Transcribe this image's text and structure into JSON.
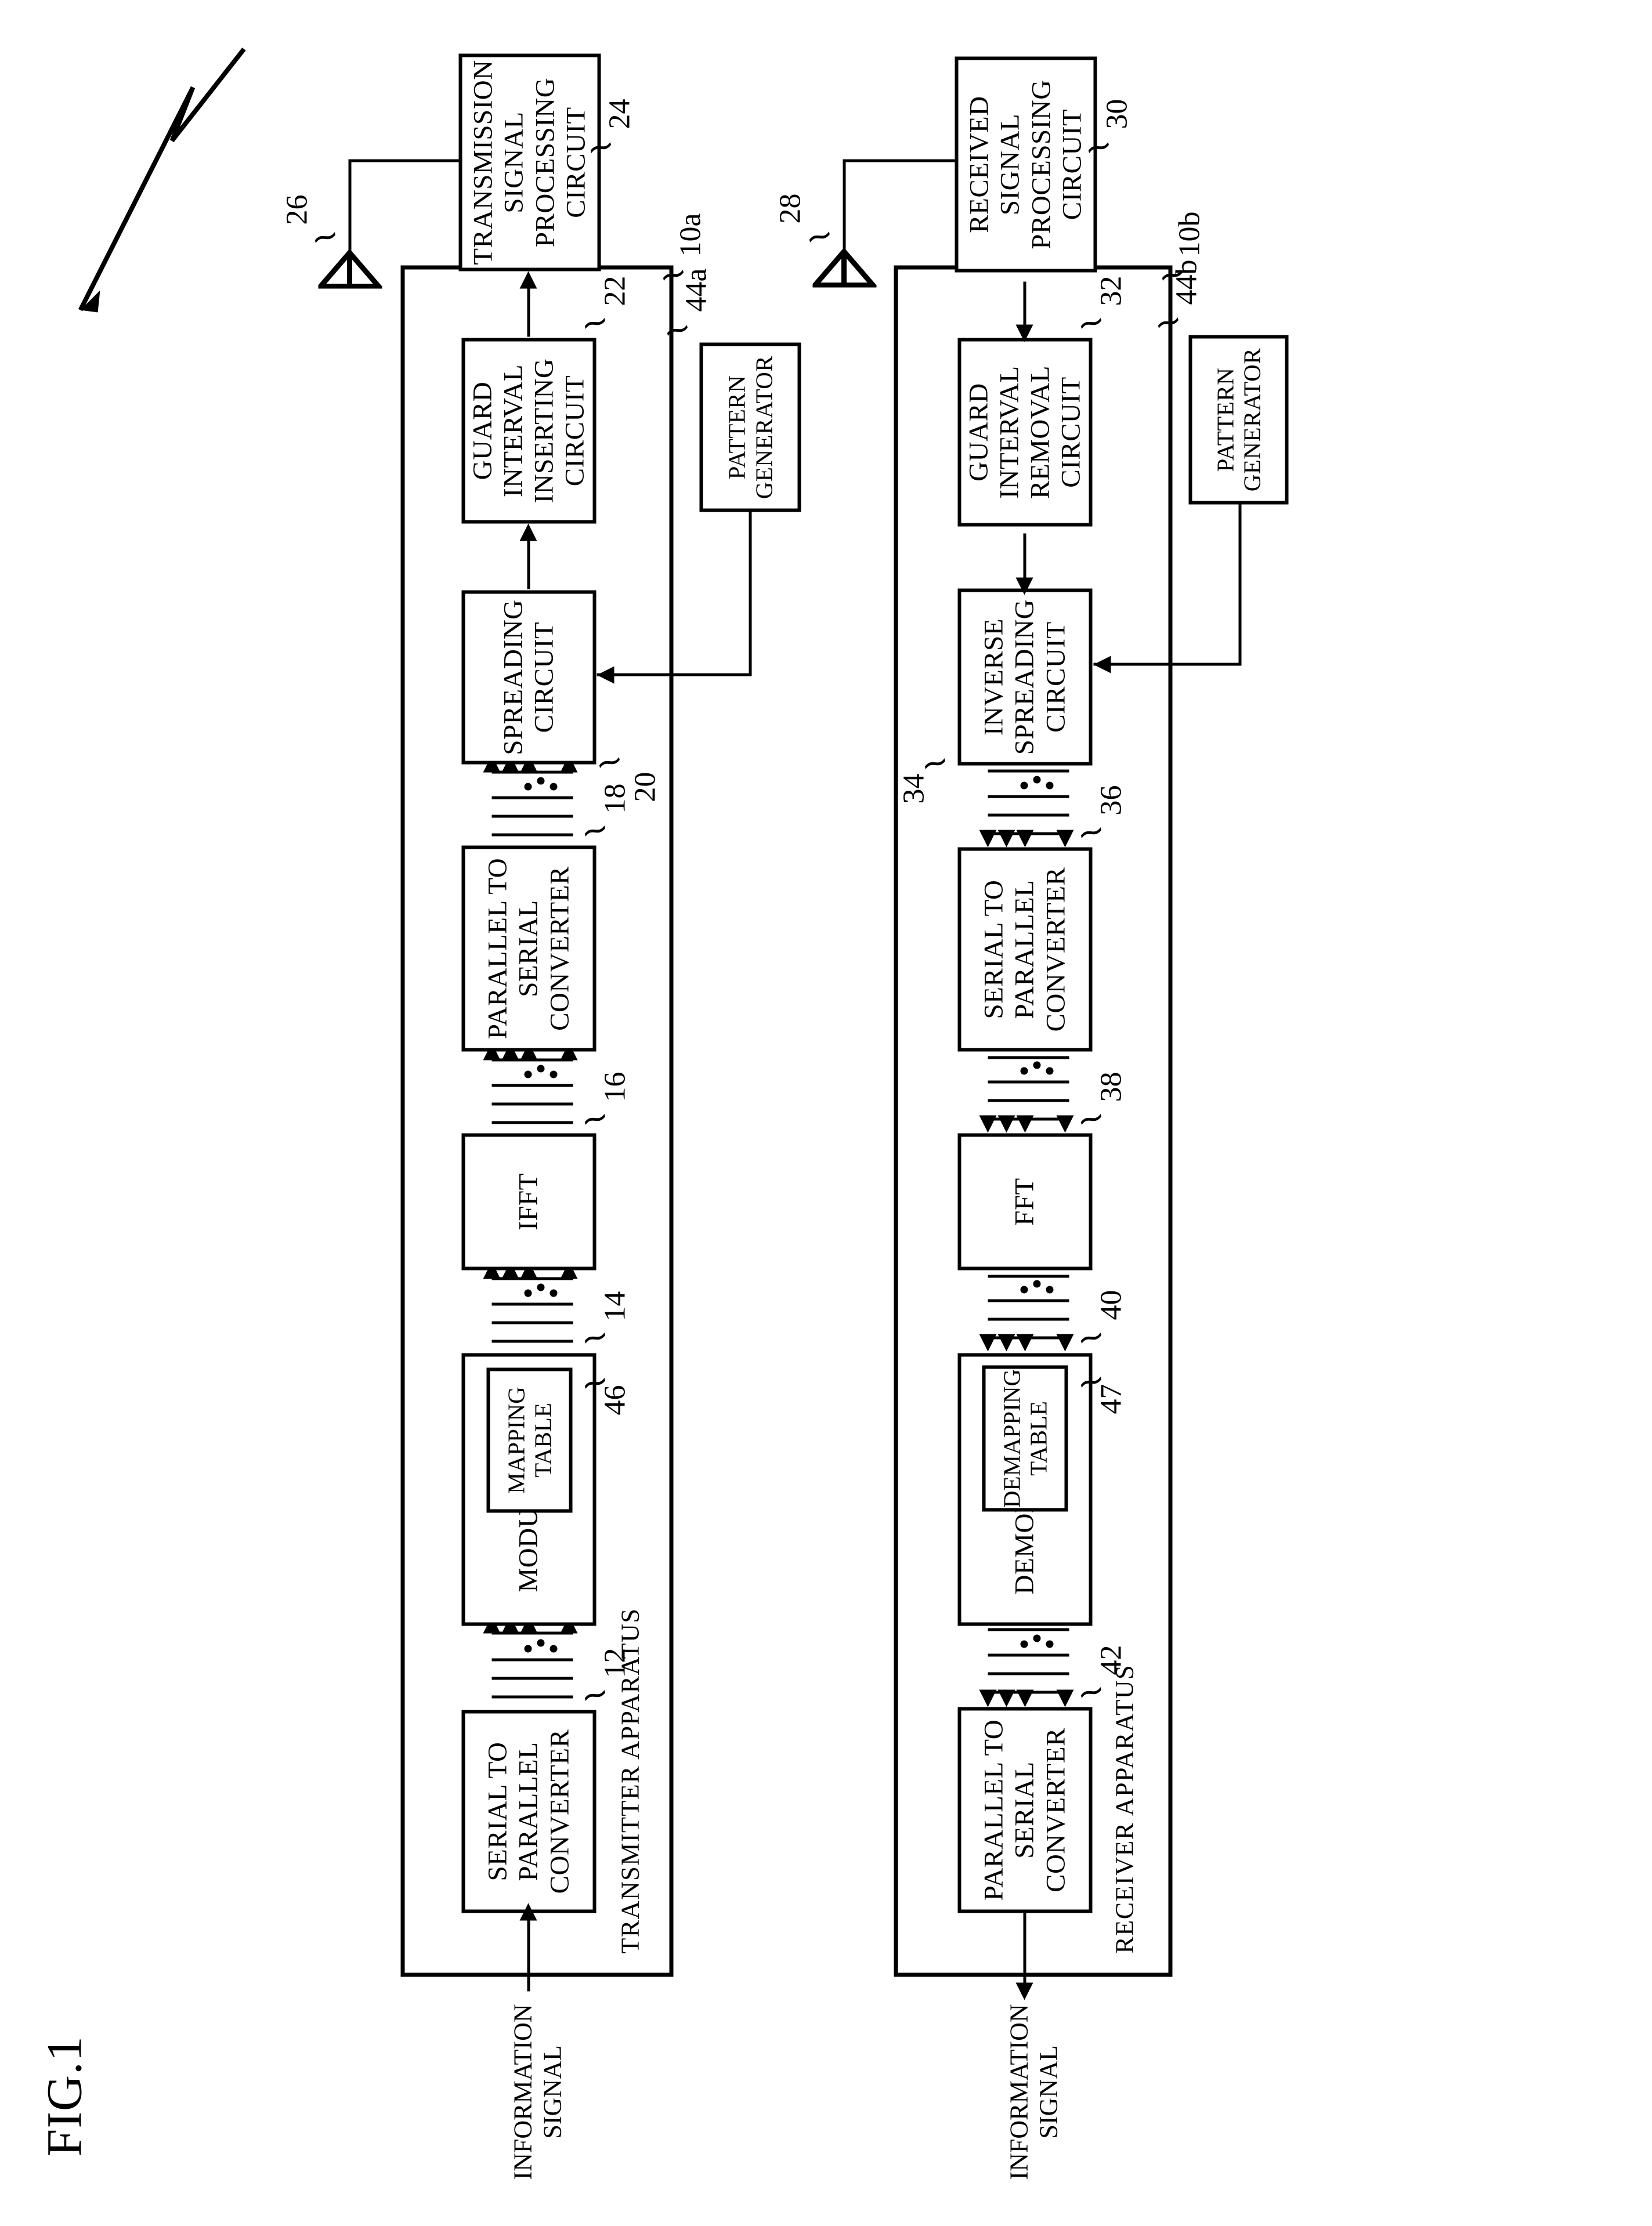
{
  "figure": {
    "label": "FIG.1",
    "type": "patent-block-diagram",
    "orientation": "rotated-90-ccw"
  },
  "transmitter": {
    "frame_label": "TRANSMITTER APPARATUS",
    "frame_ref": "10a",
    "antenna_ref": "26",
    "input_label_line1": "INFORMATION",
    "input_label_line2": "SIGNAL",
    "blocks": [
      {
        "ref": "12",
        "lines": [
          "SERIAL TO",
          "PARALLEL",
          "CONVERTER"
        ]
      },
      {
        "ref": "14",
        "lines": [
          "MODULATOR"
        ]
      },
      {
        "ref": "46",
        "lines": [
          "MAPPING",
          "TABLE"
        ]
      },
      {
        "ref": "16",
        "lines": [
          "IFFT"
        ]
      },
      {
        "ref": "18",
        "lines": [
          "PARALLEL TO",
          "SERIAL",
          "CONVERTER"
        ]
      },
      {
        "ref": "20",
        "lines": [
          "SPREADING",
          "CIRCUIT"
        ]
      },
      {
        "ref": "22",
        "lines": [
          "GUARD",
          "INTERVAL",
          "INSERTING",
          "CIRCUIT"
        ]
      },
      {
        "ref": "24",
        "lines": [
          "TRANSMISSION",
          "SIGNAL",
          "PROCESSING",
          "CIRCUIT"
        ]
      },
      {
        "ref": "44a",
        "lines": [
          "PATTERN",
          "GENERATOR"
        ]
      }
    ]
  },
  "receiver": {
    "frame_label": "RECEIVER APPARATUS",
    "frame_ref": "10b",
    "antenna_ref": "28",
    "output_label_line1": "INFORMATION",
    "output_label_line2": "SIGNAL",
    "blocks": [
      {
        "ref": "30",
        "lines": [
          "RECEIVED",
          "SIGNAL",
          "PROCESSING",
          "CIRCUIT"
        ]
      },
      {
        "ref": "32",
        "lines": [
          "GUARD",
          "INTERVAL",
          "REMOVAL",
          "CIRCUIT"
        ]
      },
      {
        "ref": "34",
        "lines": [
          "INVERSE",
          "SPREADING",
          "CIRCUIT"
        ]
      },
      {
        "ref": "36",
        "lines": [
          "SERIAL TO",
          "PARALLEL",
          "CONVERTER"
        ]
      },
      {
        "ref": "38",
        "lines": [
          "FFT"
        ]
      },
      {
        "ref": "40",
        "lines": [
          "DEMODULATOR"
        ]
      },
      {
        "ref": "47",
        "lines": [
          "DEMAPPING",
          "TABLE"
        ]
      },
      {
        "ref": "42",
        "lines": [
          "PARALLEL TO",
          "SERIAL",
          "CONVERTER"
        ]
      },
      {
        "ref": "44b",
        "lines": [
          "PATTERN",
          "GENERATOR"
        ]
      }
    ]
  },
  "colors": {
    "ink": "#000000",
    "paper": "#ffffff"
  }
}
